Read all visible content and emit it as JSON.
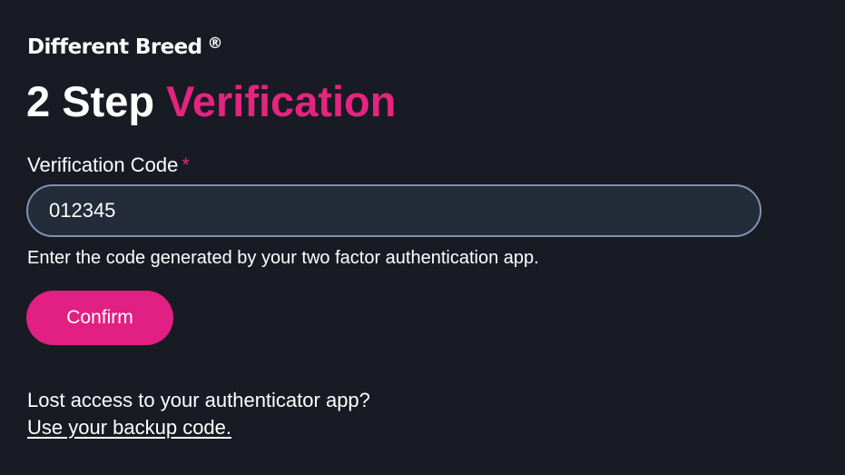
{
  "brand": {
    "name": "Different Breed",
    "registered_mark": "®"
  },
  "heading": {
    "part1": "2 Step",
    "part2": "Verification"
  },
  "form": {
    "label": "Verification Code",
    "required_marker": "*",
    "value": "012345",
    "help": "Enter the code generated by your two factor authentication app.",
    "submit_label": "Confirm"
  },
  "recovery": {
    "prompt": "Lost access to your authenticator app?",
    "link": "Use your backup code."
  },
  "colors": {
    "background": "#181b23",
    "accent": "#e5247f",
    "button": "#e21f82",
    "input_background": "#242b39",
    "input_border": "#7e93b3",
    "text": "#ffffff"
  }
}
